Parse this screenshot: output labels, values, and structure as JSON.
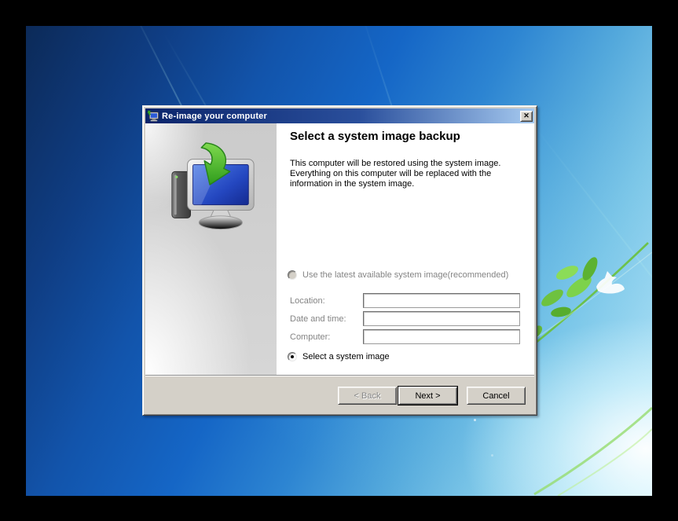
{
  "window": {
    "title": "Re-image your computer",
    "close_glyph": "✕"
  },
  "icons": {
    "titlebar": "reimage-computer-icon",
    "close": "close-icon",
    "panel_art": "computer-restore-illustration",
    "wallpaper_art": "branch-and-bird"
  },
  "colors": {
    "titlebar_gradient_start": "#0a246a",
    "titlebar_gradient_end": "#a6caf0",
    "dialog_face": "#d4d0c8",
    "content_background": "#ffffff",
    "disabled_text": "#848484",
    "desktop_blue": "#1566c6"
  },
  "wizard": {
    "heading": "Select a system image backup",
    "description": "This computer will be restored using the system image. Everything on this computer will be replaced with the information in the system image.",
    "option_latest": {
      "label": "Use the latest available system image(recommended)",
      "selected": false,
      "enabled": false
    },
    "fields": [
      {
        "label": "Location:",
        "value": ""
      },
      {
        "label": "Date and time:",
        "value": ""
      },
      {
        "label": "Computer:",
        "value": ""
      }
    ],
    "option_select": {
      "label": "Select a system image",
      "selected": true,
      "enabled": true
    },
    "buttons": {
      "back": {
        "label": "< Back",
        "enabled": false
      },
      "next": {
        "label": "Next >",
        "enabled": true,
        "default": true
      },
      "cancel": {
        "label": "Cancel",
        "enabled": true
      }
    }
  }
}
